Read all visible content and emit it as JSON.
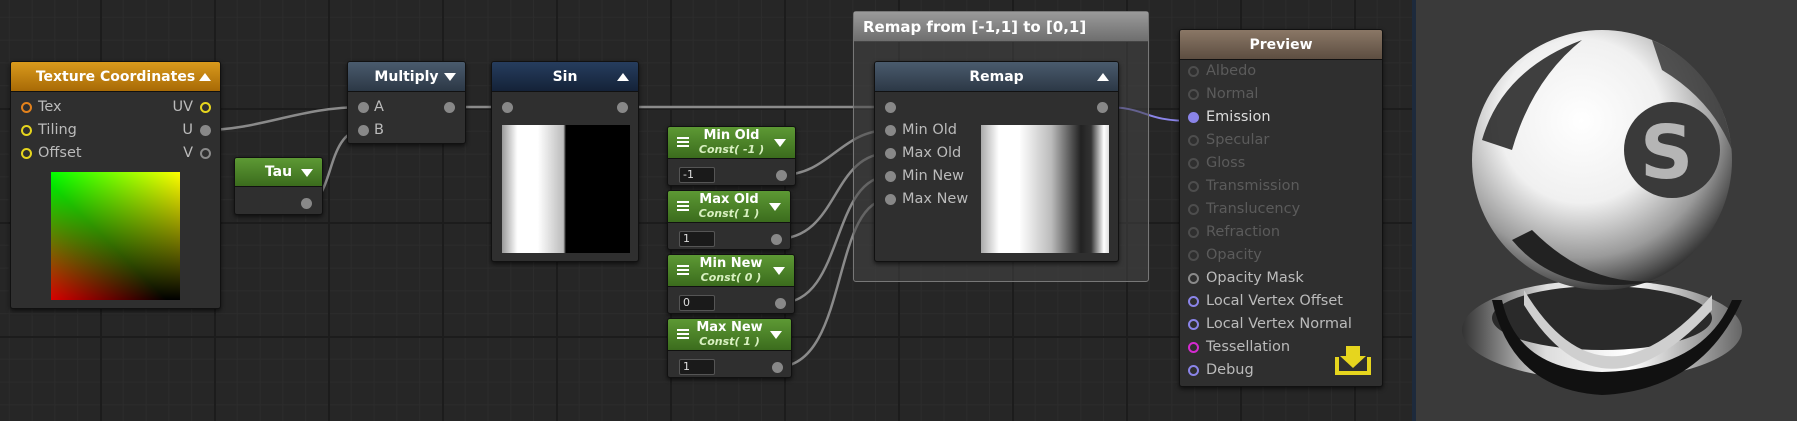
{
  "nodes": {
    "texcoord": {
      "title": "Texture Coordinates",
      "inputs": [
        "Tex",
        "Tiling",
        "Offset"
      ],
      "outputs": [
        "UV",
        "U",
        "V"
      ]
    },
    "tau": {
      "title": "Tau"
    },
    "multiply": {
      "title": "Multiply",
      "inputs": [
        "A",
        "B"
      ]
    },
    "sin": {
      "title": "Sin"
    },
    "min_old": {
      "title": "Min Old",
      "subtitle": "Const( -1 )",
      "value": "-1"
    },
    "max_old": {
      "title": "Max Old",
      "subtitle": "Const( 1 )",
      "value": "1"
    },
    "min_new": {
      "title": "Min New",
      "subtitle": "Const( 0 )",
      "value": "0"
    },
    "max_new": {
      "title": "Max New",
      "subtitle": "Const( 1 )",
      "value": "1"
    },
    "group": {
      "title": "Remap from [-1,1] to [0,1]"
    },
    "remap": {
      "title": "Remap",
      "inputs": [
        "Min Old",
        "Max Old",
        "Min New",
        "Max New"
      ]
    },
    "preview": {
      "title": "Preview",
      "inputs": [
        "Albedo",
        "Normal",
        "Emission",
        "Specular",
        "Gloss",
        "Transmission",
        "Translucency",
        "Refraction",
        "Opacity",
        "Opacity Mask",
        "Local Vertex Offset",
        "Local Vertex Normal",
        "Tessellation",
        "Debug"
      ]
    }
  },
  "icons": {
    "preview_badge": "download-tray-icon",
    "material_preview": "sphere-on-stand-icon"
  },
  "colors": {
    "wire": "#8a8a8a",
    "emission_wire": "#8a84e8",
    "tex_port": "#e4821c",
    "float_port": "#e6d51e",
    "vertex_port": "#8a84e8",
    "tessellation_port": "#d42ad0",
    "import_icon": "#e6d51e"
  }
}
